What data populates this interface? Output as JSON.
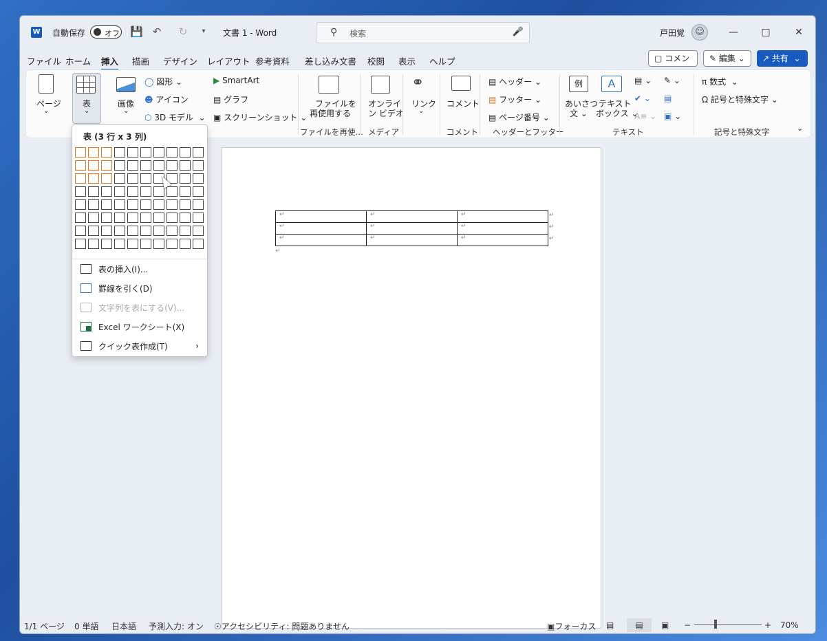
{
  "titlebar": {
    "autosave_label": "自動保存",
    "autosave_state": "オフ",
    "doc_title": "文書 1  -  Word",
    "search_placeholder": "検索",
    "user_name": "戸田覚",
    "logo": "W"
  },
  "tabs": [
    "ファイル",
    "ホーム",
    "挿入",
    "描画",
    "デザイン",
    "レイアウト",
    "参考資料",
    "差し込み文書",
    "校閲",
    "表示",
    "ヘルプ"
  ],
  "active_tab": "挿入",
  "actions": {
    "comment": "コメント",
    "edit": "編集",
    "share": "共有"
  },
  "ribbon": {
    "page": "ページ",
    "table": "表",
    "image": "画像",
    "shapes": "図形",
    "icons": "アイコン",
    "models3d": "3D モデル",
    "smartart": "SmartArt",
    "chart": "グラフ",
    "screenshot": "スクリーンショット",
    "reuse_files_l1": "ファイルを",
    "reuse_files_l2": "再使用する",
    "online_video_l1": "オンライ",
    "online_video_l2": "ン ビデオ",
    "link": "リンク",
    "comment": "コメント",
    "header": "ヘッダー",
    "footer": "フッター",
    "page_number": "ページ番号",
    "greeting_l1": "あいさつ",
    "greeting_l2": "文",
    "textbox_l1": "テキスト",
    "textbox_l2": "ボックス",
    "equation": "数式",
    "symbols": "記号と特殊文字",
    "group_labels": {
      "reuse": "ファイルを再使…",
      "media": "メディア",
      "comment": "コメント",
      "header_footer": "ヘッダーとフッター",
      "text": "テキスト",
      "symbols": "記号と特殊文字"
    }
  },
  "table_dropdown": {
    "title": "表 (3 行 x 3 列)",
    "rows_selected": 3,
    "cols_selected": 3,
    "grid_rows": 8,
    "grid_cols": 10,
    "items": [
      {
        "label": "表の挿入(I)...",
        "enabled": true
      },
      {
        "label": "罫線を引く(D)",
        "enabled": true
      },
      {
        "label": "文字列を表にする(V)...",
        "enabled": false
      },
      {
        "label": "Excel ワークシート(X)",
        "enabled": true
      },
      {
        "label": "クイック表作成(T)",
        "enabled": true
      }
    ]
  },
  "document": {
    "table_rows": 3,
    "table_cols": 3,
    "cell_mark": "↵"
  },
  "statusbar": {
    "page": "1/1 ページ",
    "words": "0 単語",
    "language": "日本語",
    "predictive": "予測入力: オン",
    "accessibility": "アクセシビリティ: 問題ありません",
    "focus": "フォーカス",
    "zoom": "70%"
  }
}
